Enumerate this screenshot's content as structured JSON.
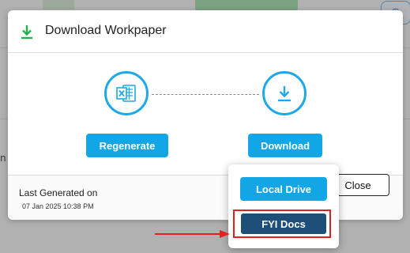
{
  "modal": {
    "title": "Download Workpaper",
    "regenerate_label": "Regenerate",
    "download_label": "Download",
    "last_generated_label": "Last Generated on",
    "last_generated_value": "07 Jan 2025 10:38 PM",
    "close_label": "Close"
  },
  "dropdown": {
    "local_drive_label": "Local Drive",
    "fyi_docs_label": "FYI Docs"
  },
  "colors": {
    "accent": "#12a6e6",
    "download_icon": "#23b04a",
    "fyi_button": "#1d4f78",
    "highlight": "#e32020"
  },
  "icons": {
    "header": "download-icon",
    "regenerate": "excel-file-icon",
    "download": "download-icon",
    "annotation": "red-arrow-icon"
  }
}
